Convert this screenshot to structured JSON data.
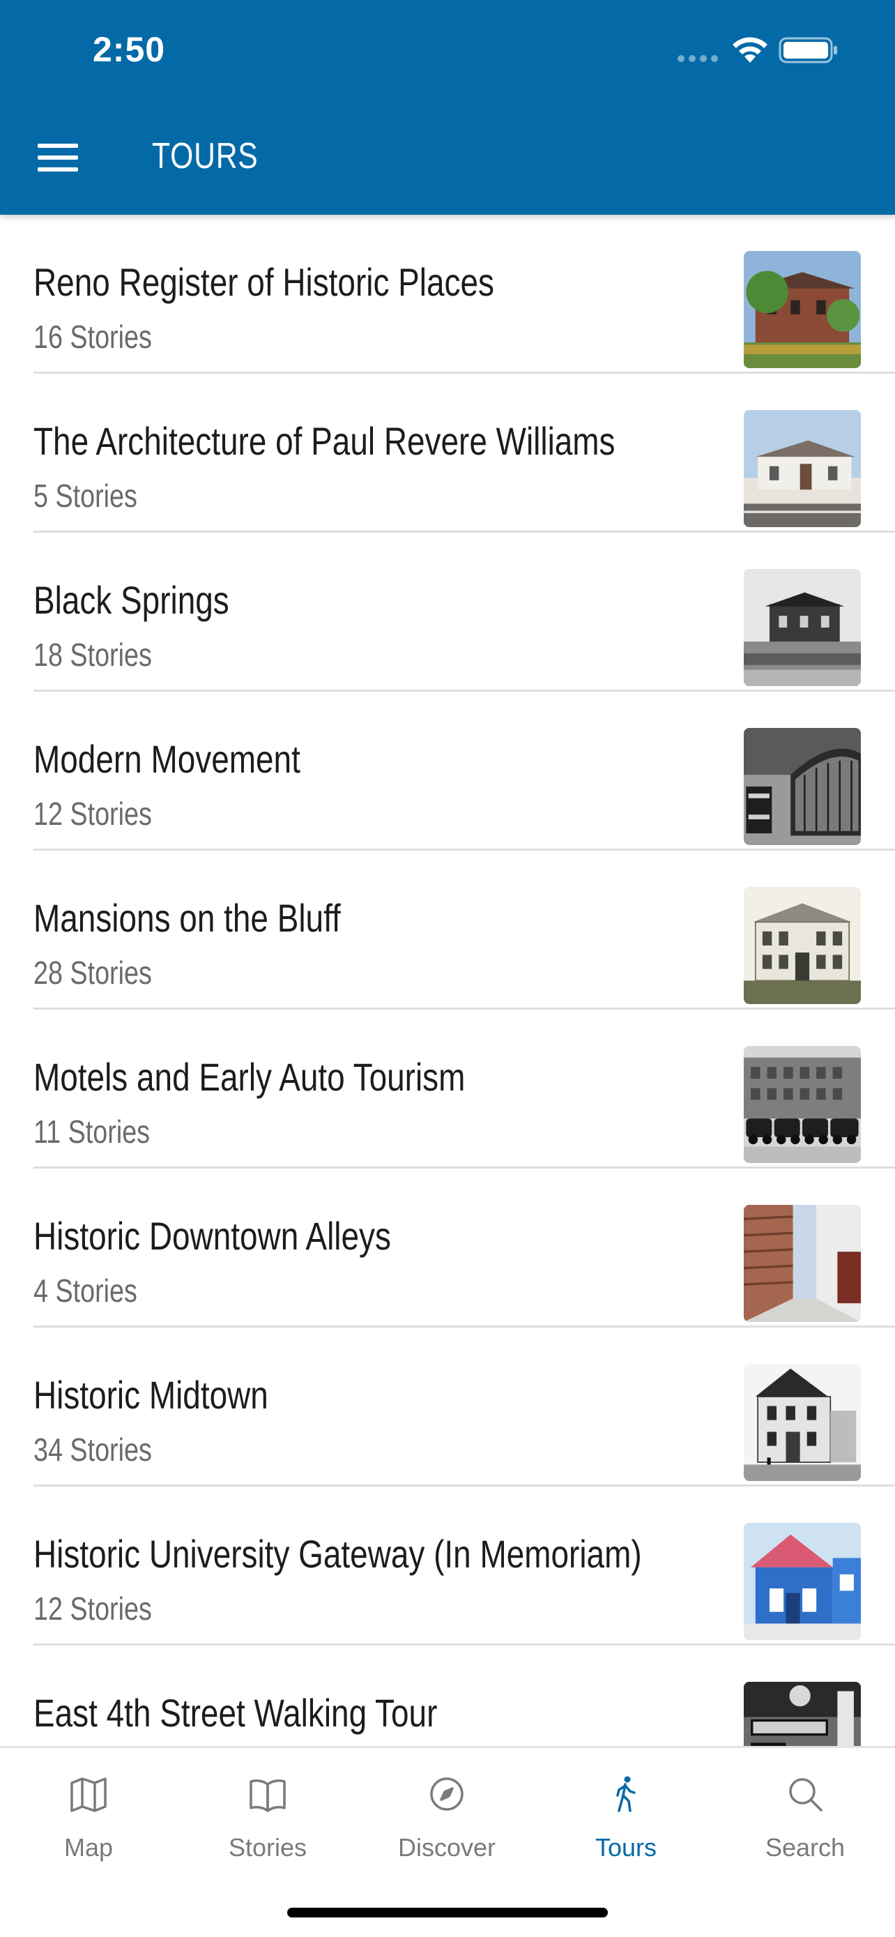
{
  "status_bar": {
    "time": "2:50",
    "wifi_icon": "wifi-icon",
    "battery_icon": "battery-icon"
  },
  "header": {
    "title": "TOURS",
    "menu_icon": "hamburger-menu-icon",
    "background": "#036aa7"
  },
  "tours": [
    {
      "title": "Reno Register of Historic Places",
      "count": "16 Stories",
      "thumbnail": "brick-house-photo"
    },
    {
      "title": "The Architecture of Paul Revere Williams",
      "count": "5 Stories",
      "thumbnail": "white-house-photo"
    },
    {
      "title": "Black Springs",
      "count": "18 Stories",
      "thumbnail": "bw-house-photo"
    },
    {
      "title": "Modern Movement",
      "count": "12 Stories",
      "thumbnail": "planetarium-photo"
    },
    {
      "title": "Mansions on the Bluff",
      "count": "28 Stories",
      "thumbnail": "mansion-photo"
    },
    {
      "title": "Motels and Early Auto Tourism",
      "count": "11 Stories",
      "thumbnail": "vintage-cars-photo"
    },
    {
      "title": "Historic Downtown Alleys",
      "count": "4 Stories",
      "thumbnail": "alley-photo"
    },
    {
      "title": "Historic Midtown",
      "count": "34 Stories",
      "thumbnail": "victorian-house-photo"
    },
    {
      "title": "Historic University Gateway (In Memoriam)",
      "count": "12 Stories",
      "thumbnail": "blue-house-photo"
    },
    {
      "title": "East 4th Street Walking Tour",
      "count": "",
      "thumbnail": "lincoln-bar-photo"
    }
  ],
  "tabbar": {
    "tabs": [
      {
        "label": "Map",
        "icon": "map-icon",
        "active": false
      },
      {
        "label": "Stories",
        "icon": "book-icon",
        "active": false
      },
      {
        "label": "Discover",
        "icon": "compass-icon",
        "active": false
      },
      {
        "label": "Tours",
        "icon": "walking-person-icon",
        "active": true
      },
      {
        "label": "Search",
        "icon": "search-icon",
        "active": false
      }
    ],
    "active_color": "#036aa7",
    "inactive_color": "#7a7a7a"
  }
}
